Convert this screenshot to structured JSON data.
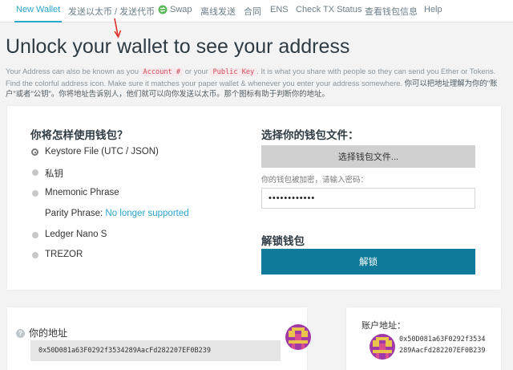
{
  "nav": {
    "items": [
      "New Wallet",
      "发送以太币 / 发送代币",
      "Swap",
      "离线发送",
      "合同",
      "ENS",
      "Check TX Status",
      "查看钱包信息",
      "Help"
    ],
    "active_color": "#2ca6c9"
  },
  "page": {
    "title": "Unlock your wallet to see your address",
    "desc": {
      "part1": "Your Address can also be known as you ",
      "code1": "Account #",
      "part2": " or your ",
      "code2": "Public Key",
      "part3": ". It is what you share with people so they can send you Ether or Tokens. Find the colorful address icon. Make sure it matches your paper wallet & whenever you enter your address somewhere. ",
      "zh": "你可以把地址理解为你的\"账户\"或者\"公钥\"。你将地址告诉别人，他们就可以向你发送以太币。那个图标有助于判断你的地址。"
    }
  },
  "access": {
    "heading": "你将怎样使用钱包？",
    "options": [
      {
        "label": "Keystore File (UTC / JSON)",
        "checked": true
      },
      {
        "label": "私钥",
        "checked": false
      },
      {
        "label": "Mnemonic Phrase",
        "checked": false
      },
      {
        "label": "Ledger Nano S",
        "checked": false
      },
      {
        "label": "TREZOR",
        "checked": false
      }
    ],
    "parity_label": "Parity Phrase: ",
    "parity_link": "No longer supported"
  },
  "file": {
    "heading": "选择你的钱包文件：",
    "button": "选择钱包文件...",
    "password_label": "你的钱包被加密，请输入密码：",
    "password_value": "••••••••••••"
  },
  "unlock": {
    "heading": "解锁钱包",
    "button": "解锁",
    "button_color": "#0f7a99"
  },
  "address": {
    "label": "你的地址",
    "value": "0x50D081a63F0292f3534289AacFd282207EF0B239",
    "help_glyph": "?"
  },
  "account": {
    "label": "账户地址：",
    "value": "0x50D081a63F0292f3534289AacFd282207EF0B239"
  }
}
